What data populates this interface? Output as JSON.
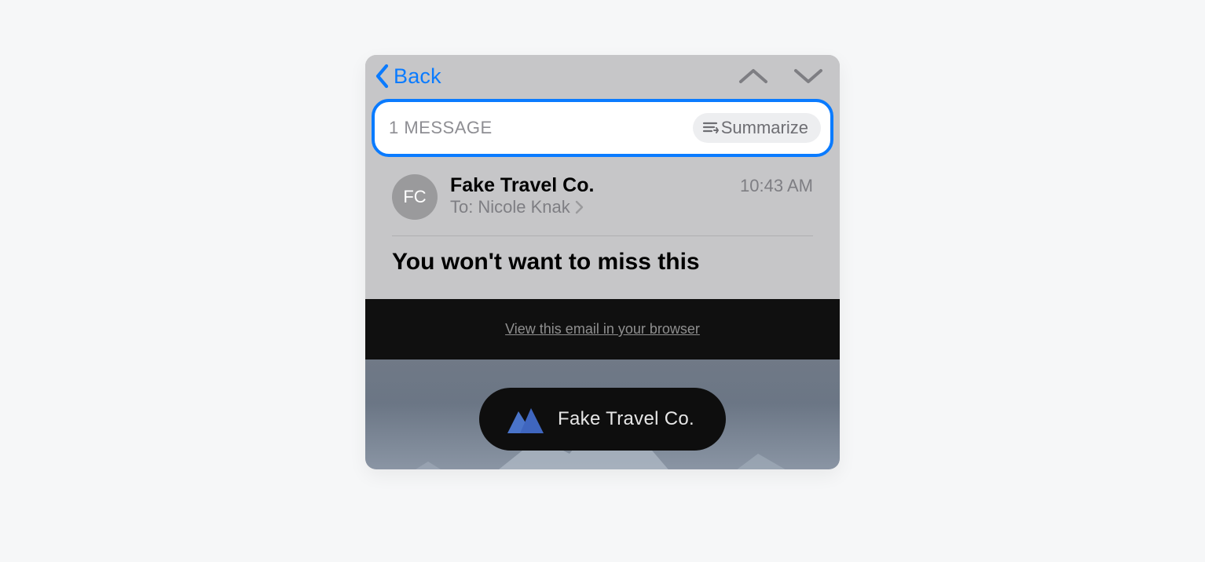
{
  "nav": {
    "back_label": "Back"
  },
  "banner": {
    "count_label": "1 MESSAGE",
    "summarize_label": "Summarize"
  },
  "message": {
    "avatar_initials": "FC",
    "sender": "Fake Travel Co.",
    "timestamp": "10:43 AM",
    "to_prefix": "To:",
    "to_name": "Nicole Knak",
    "subject": "You won't want to miss this"
  },
  "body": {
    "view_in_browser": "View this email in your browser",
    "brand_name": "Fake Travel Co."
  },
  "colors": {
    "accent": "#0a7bff"
  }
}
